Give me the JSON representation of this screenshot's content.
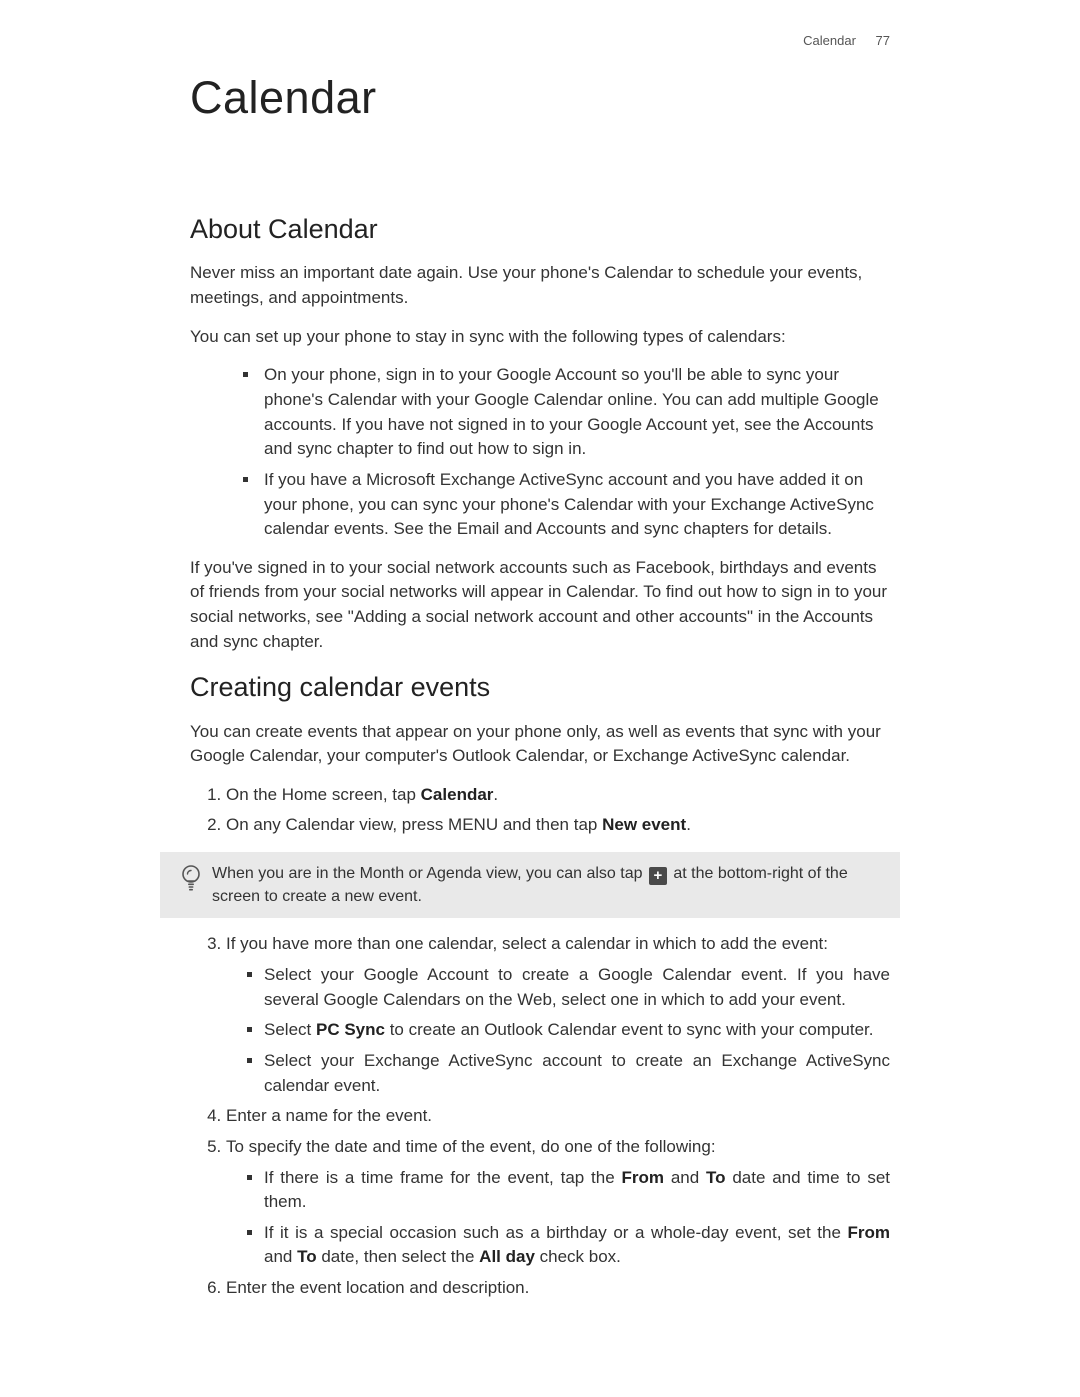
{
  "header": {
    "section": "Calendar",
    "page_num": "77"
  },
  "chapter_title": "Calendar",
  "s1": {
    "title": "About Calendar",
    "p1": "Never miss an important date again. Use your phone's Calendar to schedule your events, meetings, and appointments.",
    "p2": "You can set up your phone to stay in sync with the following types of calendars:",
    "bullets": [
      "On your phone, sign in to your Google Account so you'll be able to sync your phone's Calendar with your Google Calendar online. You can add multiple Google accounts. If you have not signed in to your Google Account yet, see the Accounts and sync chapter to find out how to sign in.",
      "If you have a Microsoft Exchange ActiveSync account and you have added it on your phone, you can sync your phone's Calendar with your Exchange ActiveSync calendar events. See the Email and Accounts and sync chapters for details."
    ],
    "p3": "If you've signed in to your social network accounts such as Facebook, birthdays and events of friends from your social networks will appear in Calendar. To find out how to sign in to your social networks, see \"Adding a social network account and other accounts\" in the Accounts and sync chapter."
  },
  "s2": {
    "title": "Creating calendar events",
    "intro": "You can create events that appear on your phone only, as well as events that sync with your Google Calendar, your computer's Outlook Calendar, or Exchange ActiveSync calendar.",
    "step1_pre": "On the Home screen, tap ",
    "step1_bold": "Calendar",
    "step1_post": ".",
    "step2_pre": "On any Calendar view, press MENU and then tap ",
    "step2_bold": "New event",
    "step2_post": ".",
    "tip_pre": "When you are in the Month or Agenda view, you can also tap ",
    "tip_post": " at the bottom-right of the screen to create a new event.",
    "step3_intro": "If you have more than one calendar, select a calendar in which to add the event:",
    "step3_sub1": "Select your Google Account to create a Google Calendar event. If you have several Google Calendars on the Web, select one in which to add your event.",
    "step3_sub2_pre": "Select ",
    "step3_sub2_bold": "PC Sync",
    "step3_sub2_post": " to create an Outlook Calendar event to sync with your computer.",
    "step3_sub3": "Select your Exchange ActiveSync account to create an Exchange ActiveSync calendar event.",
    "step4": "Enter a name for the event.",
    "step5_intro": "To specify the date and time of the event, do one of the following:",
    "step5_sub1_a": "If there is a time frame for the event, tap the ",
    "step5_sub1_b": "From",
    "step5_sub1_c": " and ",
    "step5_sub1_d": "To",
    "step5_sub1_e": " date and time to set them.",
    "step5_sub2_a": "If it is a special occasion such as a birthday or a whole-day event, set the ",
    "step5_sub2_b": "From",
    "step5_sub2_c": " and ",
    "step5_sub2_d": "To",
    "step5_sub2_e": " date, then select the ",
    "step5_sub2_f": "All day",
    "step5_sub2_g": " check box.",
    "step6": "Enter the event location and description."
  },
  "icons": {
    "plus": "+"
  }
}
